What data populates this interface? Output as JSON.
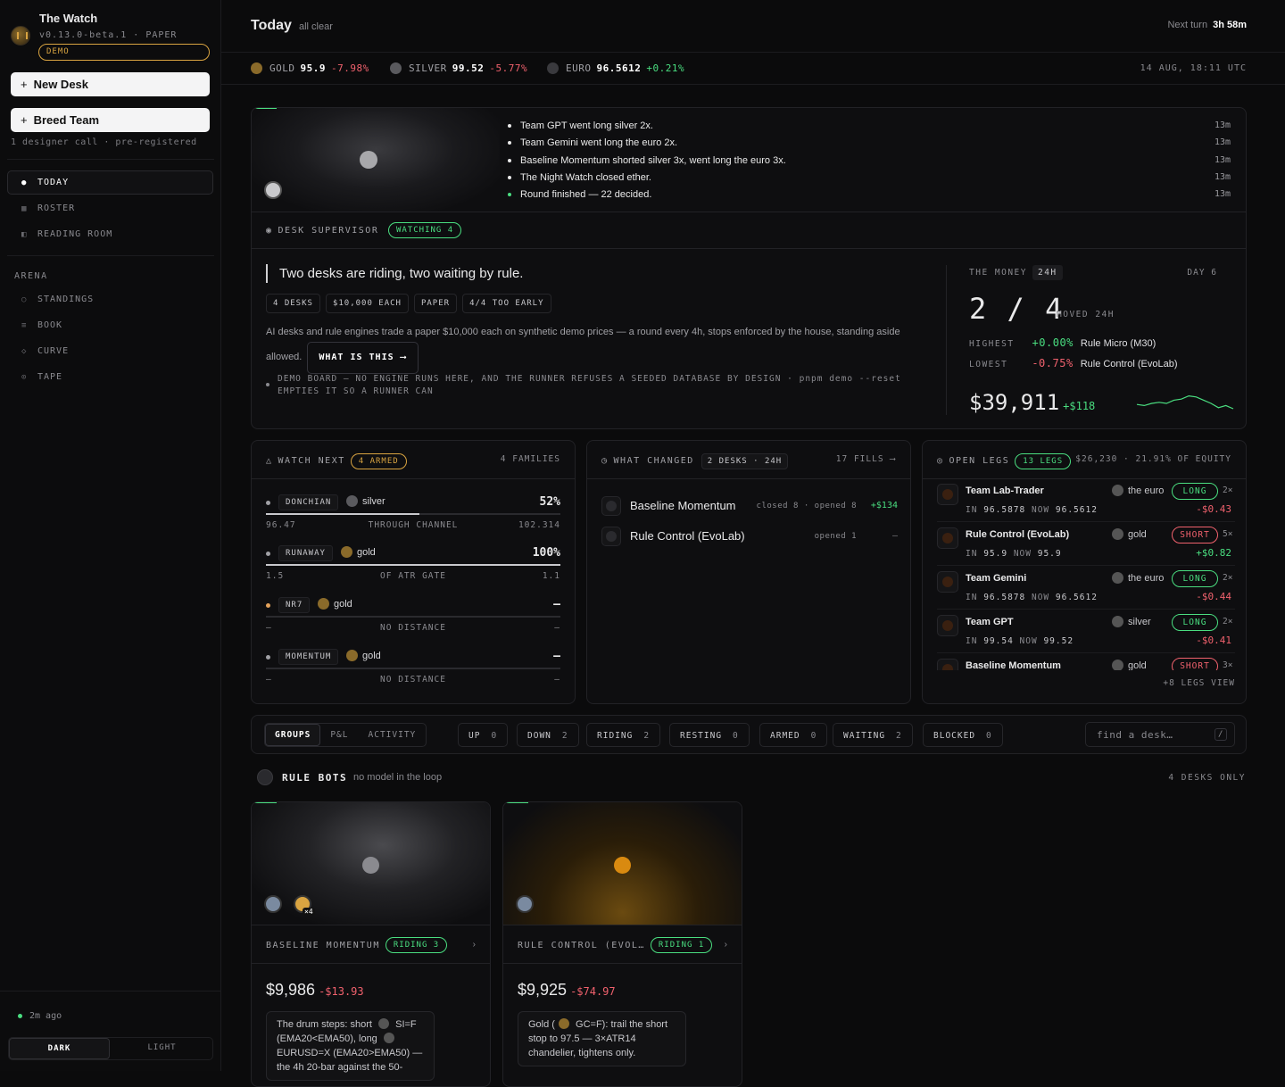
{
  "app": {
    "title": "The Watch",
    "version": "v0.13.0-beta.1 · PAPER",
    "badge": "DEMO"
  },
  "sidebar": {
    "new_desk": "New Desk",
    "breed_team": "Breed Team",
    "note": "1 designer call · pre-registered",
    "nav": [
      {
        "label": "TODAY",
        "icon": "dot-icon",
        "glyph": "●"
      },
      {
        "label": "ROSTER",
        "icon": "grid-icon",
        "glyph": "▦"
      },
      {
        "label": "READING ROOM",
        "icon": "book-icon",
        "glyph": "◧"
      }
    ],
    "arena_heading": "ARENA",
    "arena": [
      {
        "label": "STANDINGS",
        "icon": "circle-icon",
        "glyph": "○"
      },
      {
        "label": "BOOK",
        "icon": "lines-icon",
        "glyph": "≡"
      },
      {
        "label": "CURVE",
        "icon": "diamond-icon",
        "glyph": "◇"
      },
      {
        "label": "TAPE",
        "icon": "target-icon",
        "glyph": "⊙"
      }
    ],
    "last_sync": "2m ago",
    "theme": {
      "dark": "DARK",
      "light": "LIGHT"
    }
  },
  "header": {
    "title": "Today",
    "status": "all clear",
    "next_turn_label": "Next turn",
    "next_turn_value": "3h 58m"
  },
  "ticker": [
    {
      "name": "GOLD",
      "price": "95.9",
      "change": "-7.98%",
      "dir": "down",
      "color": "#8a6a2a"
    },
    {
      "name": "SILVER",
      "price": "99.52",
      "change": "-5.77%",
      "dir": "down",
      "color": "#5a5a5e"
    },
    {
      "name": "EURO",
      "price": "96.5612",
      "change": "+0.21%",
      "dir": "up",
      "color": "#3a3a3e"
    }
  ],
  "timestamp": "14 AUG, 18:11 UTC",
  "feed": [
    {
      "text": "Team GPT went long silver 2x.",
      "time": "13m"
    },
    {
      "text": "Team Gemini went long the euro 2x.",
      "time": "13m"
    },
    {
      "text": "Baseline Momentum shorted silver 3x, went long the euro 3x.",
      "time": "13m"
    },
    {
      "text": "The Night Watch closed ether.",
      "time": "13m"
    },
    {
      "text": "Round finished — 22 decided.",
      "time": "13m"
    }
  ],
  "supervisor": {
    "label": "DESK SUPERVISOR",
    "badge": "WATCHING 4",
    "headline": "Two desks are riding, two waiting by rule.",
    "chips": [
      "4 DESKS",
      "$10,000 EACH",
      "PAPER",
      "4/4 TOO EARLY"
    ],
    "description": "AI desks and rule engines trade a paper $10,000 each on synthetic demo prices — a round every 4h, stops enforced by the house, standing aside allowed.",
    "what_btn": "WHAT IS THIS ⟶",
    "demo_note": "DEMO BOARD — NO ENGINE RUNS HERE, AND THE RUNNER REFUSES A SEEDED DATABASE BY DESIGN · pnpm demo --reset EMPTIES IT SO A RUNNER CAN"
  },
  "money": {
    "label": "THE MONEY",
    "period": "24H",
    "day": "DAY 6",
    "ratio": "2 / 4",
    "moved": "MOVED 24H",
    "highest_label": "HIGHEST",
    "highest_value": "+0.00%",
    "highest_name": "Rule Micro (M30)",
    "lowest_label": "LOWEST",
    "lowest_value": "-0.75%",
    "lowest_name": "Rule Control (EvoLab)",
    "balance": "$39,911",
    "balance_change": "+$118"
  },
  "watch_next": {
    "title": "WATCH NEXT",
    "badge": "4 ARMED",
    "right": "4 FAMILIES",
    "rows": [
      {
        "tag": "DONCHIAN",
        "asset": "silver",
        "asset_color": "#5a5a5e",
        "pct": "52%",
        "fill": 0.52,
        "sub_left": "96.47",
        "sub_center": "THROUGH CHANNEL",
        "sub_right": "102.314",
        "dot": "gray"
      },
      {
        "tag": "RUNAWAY",
        "asset": "gold",
        "asset_color": "#8a6a2a",
        "pct": "100%",
        "fill": 1.0,
        "sub_left": "1.5",
        "sub_center": "OF ATR GATE",
        "sub_right": "1.1",
        "dot": "gray"
      },
      {
        "tag": "NR7",
        "asset": "gold",
        "asset_color": "#8a6a2a",
        "pct": "—",
        "fill": 0,
        "sub_left": "—",
        "sub_center": "NO DISTANCE",
        "sub_right": "—",
        "dot": "amber"
      },
      {
        "tag": "MOMENTUM",
        "asset": "gold",
        "asset_color": "#8a6a2a",
        "pct": "—",
        "fill": 0,
        "sub_left": "—",
        "sub_center": "NO DISTANCE",
        "sub_right": "—",
        "dot": "gray"
      }
    ]
  },
  "what_changed": {
    "title": "WHAT CHANGED",
    "badge": "2 DESKS · 24H",
    "right": "17 FILLS ⟶",
    "rows": [
      {
        "name": "Baseline Momentum",
        "stats": "closed 8 · opened 8",
        "pnl": "+$134",
        "dir": "up"
      },
      {
        "name": "Rule Control (EvoLab)",
        "stats": "opened 1",
        "pnl": "—",
        "dir": "flat"
      }
    ]
  },
  "open_legs": {
    "title": "OPEN LEGS",
    "badge": "13 LEGS",
    "right": "$26,230 · 21.91% OF EQUITY",
    "rows": [
      {
        "name": "Team Lab-Trader",
        "asset": "the euro",
        "side": "LONG",
        "lev": "2×",
        "in": "96.5878",
        "now": "96.5612",
        "pnl": "-$0.43",
        "dir": "down"
      },
      {
        "name": "Rule Control (EvoLab)",
        "asset": "gold",
        "side": "SHORT",
        "lev": "5×",
        "in": "95.9",
        "now": "95.9",
        "pnl": "+$0.82",
        "dir": "up"
      },
      {
        "name": "Team Gemini",
        "asset": "the euro",
        "side": "LONG",
        "lev": "2×",
        "in": "96.5878",
        "now": "96.5612",
        "pnl": "-$0.44",
        "dir": "down"
      },
      {
        "name": "Team GPT",
        "asset": "silver",
        "side": "LONG",
        "lev": "2×",
        "in": "99.54",
        "now": "99.52",
        "pnl": "-$0.41",
        "dir": "down"
      },
      {
        "name": "Baseline Momentum",
        "asset": "gold",
        "side": "SHORT",
        "lev": "3×",
        "in": "",
        "now": "",
        "pnl": "",
        "dir": "down"
      }
    ],
    "in_label": "IN",
    "now_label": "NOW",
    "more": "+8 LEGS VIEW"
  },
  "toolbar": {
    "views": [
      "GROUPS",
      "P&L",
      "ACTIVITY"
    ],
    "filters": [
      {
        "label": "UP",
        "count": "0"
      },
      {
        "label": "DOWN",
        "count": "2"
      },
      {
        "label": "RIDING",
        "count": "2"
      },
      {
        "label": "RESTING",
        "count": "0"
      },
      {
        "label": "ARMED",
        "count": "0"
      },
      {
        "label": "WAITING",
        "count": "2"
      },
      {
        "label": "BLOCKED",
        "count": "0"
      }
    ],
    "search_placeholder": "find a desk…",
    "search_key": "/"
  },
  "group": {
    "title": "RULE BOTS",
    "subtitle": "no model in the loop",
    "right": "4 DESKS ONLY"
  },
  "desks": [
    {
      "name": "BASELINE MOMENTUM",
      "badge": "RIDING 3",
      "value": "$9,986",
      "change": "-$13.93",
      "multi": "×4",
      "memo": [
        "The drum steps: short ",
        " SI=F (EMA20<EMA50), long ",
        " EURUSD=X (EMA20>EMA50) — the 4h 20-bar against the 50-"
      ]
    },
    {
      "name": "RULE CONTROL (EVOL…",
      "badge": "RIDING 1",
      "value": "$9,925",
      "change": "-$74.97",
      "multi": "",
      "memo": [
        "Gold (",
        " GC=F): trail the short stop to 97.5 — 3×ATR14 chandelier, tightens only."
      ]
    }
  ],
  "colors": {
    "accent": "#4ade80",
    "negative": "#f0616d",
    "amber": "#d9a441"
  },
  "sparkline": [
    0.55,
    0.6,
    0.5,
    0.45,
    0.5,
    0.35,
    0.3,
    0.15,
    0.2,
    0.35,
    0.5,
    0.7,
    0.6,
    0.75
  ]
}
